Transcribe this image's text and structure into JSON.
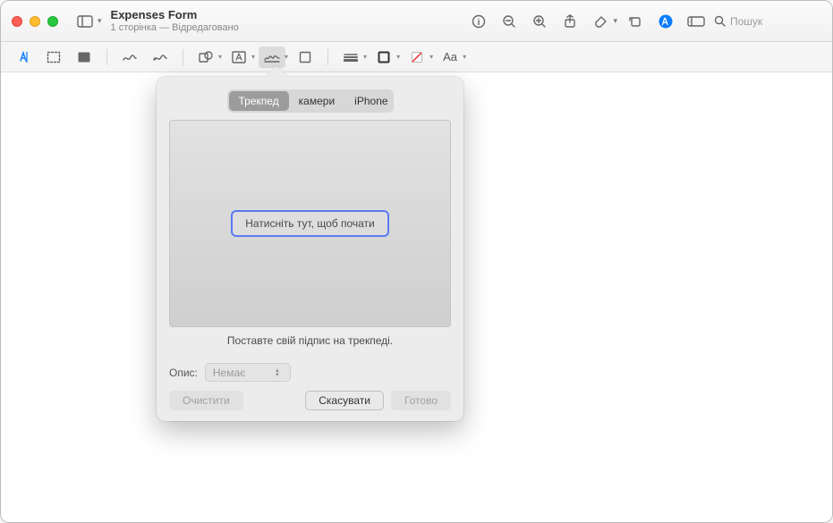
{
  "title": {
    "doc": "Expenses Form",
    "sub": "1 сторінка — Відредаговано"
  },
  "search": {
    "placeholder": "Пошук"
  },
  "popover": {
    "tabs": {
      "trackpad": "Трекпед",
      "camera": "камери",
      "iphone": "iPhone"
    },
    "start": "Натисніть тут, щоб почати",
    "instruction": "Поставте свій підпис на трекпеді.",
    "desc_label": "Опис:",
    "desc_value": "Немає",
    "buttons": {
      "clear": "Очистити",
      "cancel": "Скасувати",
      "done": "Готово"
    }
  }
}
